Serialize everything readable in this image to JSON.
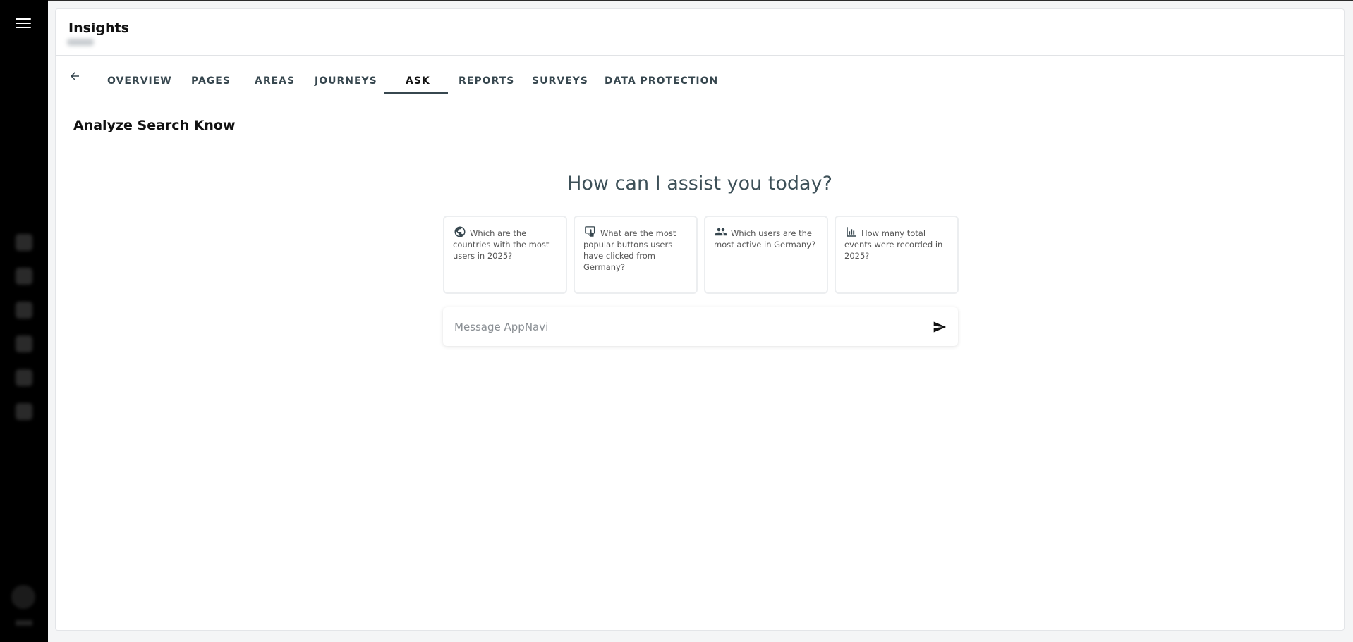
{
  "app": {
    "title": "Insights"
  },
  "tabs": [
    {
      "label": "OVERVIEW"
    },
    {
      "label": "PAGES"
    },
    {
      "label": "AREAS"
    },
    {
      "label": "JOURNEYS"
    },
    {
      "label": "ASK",
      "active": true
    },
    {
      "label": "REPORTS"
    },
    {
      "label": "SURVEYS"
    },
    {
      "label": "DATA PROTECTION"
    }
  ],
  "section": {
    "title": "Analyze Search Know"
  },
  "assistant": {
    "heading": "How can I assist you today?",
    "suggestions": [
      {
        "icon": "globe-icon",
        "text": "Which are the countries with the most users in 2025?"
      },
      {
        "icon": "touch-screen-icon",
        "text": "What are the most popular buttons users have clicked from Germany?"
      },
      {
        "icon": "users-group-icon",
        "text": "Which users are the most active in Germany?"
      },
      {
        "icon": "bar-chart-icon",
        "text": "How many total events were recorded in 2025?"
      }
    ],
    "input_placeholder": "Message AppNavi"
  },
  "colors": {
    "sidebar": "#000000",
    "text_primary": "#111111",
    "tab_text": "#37474f",
    "heading": "#3d5058"
  }
}
